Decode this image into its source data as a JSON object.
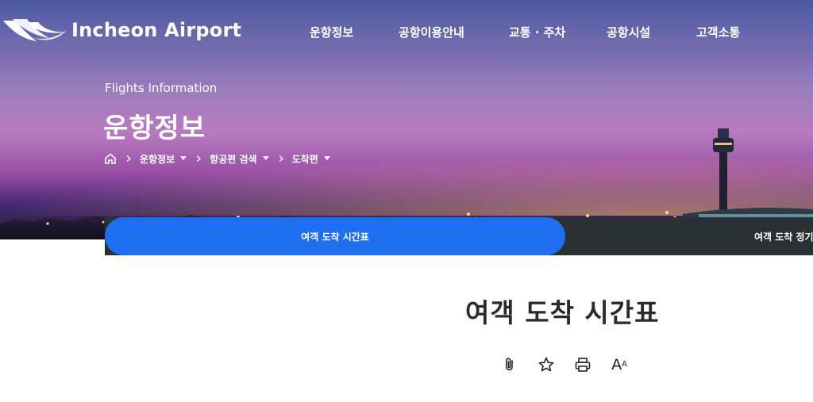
{
  "header": {
    "logo_text": "Incheon Airport",
    "nav": [
      "운항정보",
      "공항이용안내",
      "교통 · 주차",
      "공항시설",
      "고객소통"
    ]
  },
  "hero": {
    "subtitle": "Flights Information",
    "title": "운항정보",
    "breadcrumb": [
      "운항정보",
      "항공편 검색",
      "도착편"
    ]
  },
  "tabs": {
    "active": "여객 도착 시간표",
    "next": "여객 도착 정기"
  },
  "content": {
    "title": "여객 도착 시간표",
    "tools": [
      "clip-icon",
      "star-icon",
      "print-icon",
      "font-size-icon"
    ],
    "font_tool_label": "A"
  },
  "colors": {
    "accent": "#1d6ff0",
    "tabbar": "#2b3035"
  }
}
